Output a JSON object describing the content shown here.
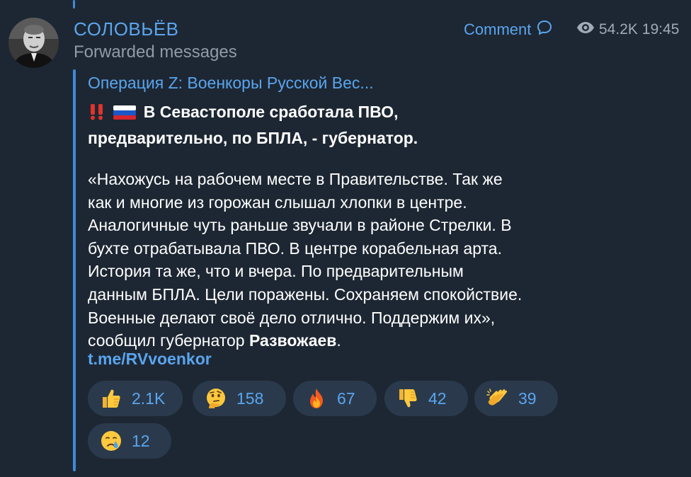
{
  "channel": {
    "name": "СОЛОВЬЁВ",
    "subtitle": "Forwarded messages",
    "avatar_icon": "person-portrait"
  },
  "header": {
    "comment_label": "Comment",
    "views": "54.2K",
    "time": "19:45"
  },
  "message": {
    "source_title": "Операция Z: Военкоры Русской Вес...",
    "headline_line1": "В Севастополе сработала ПВО,",
    "headline_line2": "предварительно, по БПЛА, - губернатор.",
    "body_lines": [
      "«Нахожусь на рабочем месте в Правительстве. Так же",
      "как и многие из горожан слышал хлопки в центре.",
      "Аналогичные чуть раньше звучали в районе Стрелки. В",
      "бухте отрабатывала ПВО. В центре корабельная арта.",
      "История та же, что и вчера. По предварительным",
      "данным БПЛА. Цели поражены. Сохраняем спокойствие.",
      "Военные делают своё дело отлично. Поддержим их»,"
    ],
    "last_line_prefix": "сообщил губернатор ",
    "governor_name": "Развожаев",
    "last_line_suffix": ".",
    "link": "t.me/RVvoenkor"
  },
  "reactions": [
    {
      "icon": "thumbs-up-icon",
      "count": "2.1K"
    },
    {
      "icon": "thinking-face-icon",
      "count": "158"
    },
    {
      "icon": "fire-icon",
      "count": "67"
    },
    {
      "icon": "thumbs-down-icon",
      "count": "42"
    },
    {
      "icon": "clapping-hands-icon",
      "count": "39"
    },
    {
      "icon": "crying-face-icon",
      "count": "12"
    }
  ],
  "colors": {
    "background": "#1d2733",
    "accent": "#5aa5ee",
    "bar": "#3f8ad8",
    "reaction_bg": "#2a3a4c",
    "muted": "#8f9ba8"
  }
}
